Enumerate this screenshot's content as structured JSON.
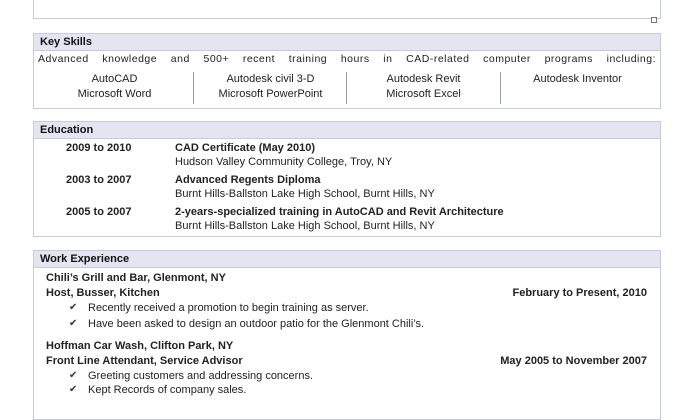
{
  "skills": {
    "heading": "Key Skills",
    "intro": "Advanced knowledge and 500+ recent training hours in CAD-related computer programs including:",
    "columns": [
      [
        "AutoCAD",
        "Microsoft Word"
      ],
      [
        "Autodesk civil 3-D",
        "Microsoft PowerPoint"
      ],
      [
        "Autodesk Revit",
        "Microsoft Excel"
      ],
      [
        "Autodesk Inventor"
      ]
    ]
  },
  "education": {
    "heading": "Education",
    "entries": [
      {
        "years": "2009 to 2010",
        "title": "CAD Certificate (May 2010)",
        "school": "Hudson Valley Community College, Troy, NY"
      },
      {
        "years": "2003 to 2007",
        "title": "Advanced Regents Diploma",
        "school": "Burnt Hills-Ballston Lake High School, Burnt Hills, NY"
      },
      {
        "years": "2005 to 2007",
        "title": "2-years-specialized training in AutoCAD and Revit Architecture",
        "school": "Burnt Hills-Ballston Lake High School, Burnt Hills, NY"
      }
    ]
  },
  "work": {
    "heading": "Work Experience",
    "jobs": [
      {
        "employer": "Chili’s Grill and Bar, Glenmont, NY",
        "role": "Host, Busser, Kitchen",
        "dates": "February to Present, 2010",
        "bullets": [
          "Recently received a promotion to begin training as server.",
          "Have been asked to design an outdoor patio for the Glenmont Chili’s."
        ]
      },
      {
        "employer": "Hoffman Car Wash, Clifton Park, NY",
        "role": "Front Line Attendant,  Service Advisor",
        "dates": "May 2005 to November 2007",
        "bullets": [
          "Greeting customers and addressing concerns.",
          "Kept Records of company sales."
        ]
      }
    ]
  },
  "icons": {
    "check": "✔"
  }
}
